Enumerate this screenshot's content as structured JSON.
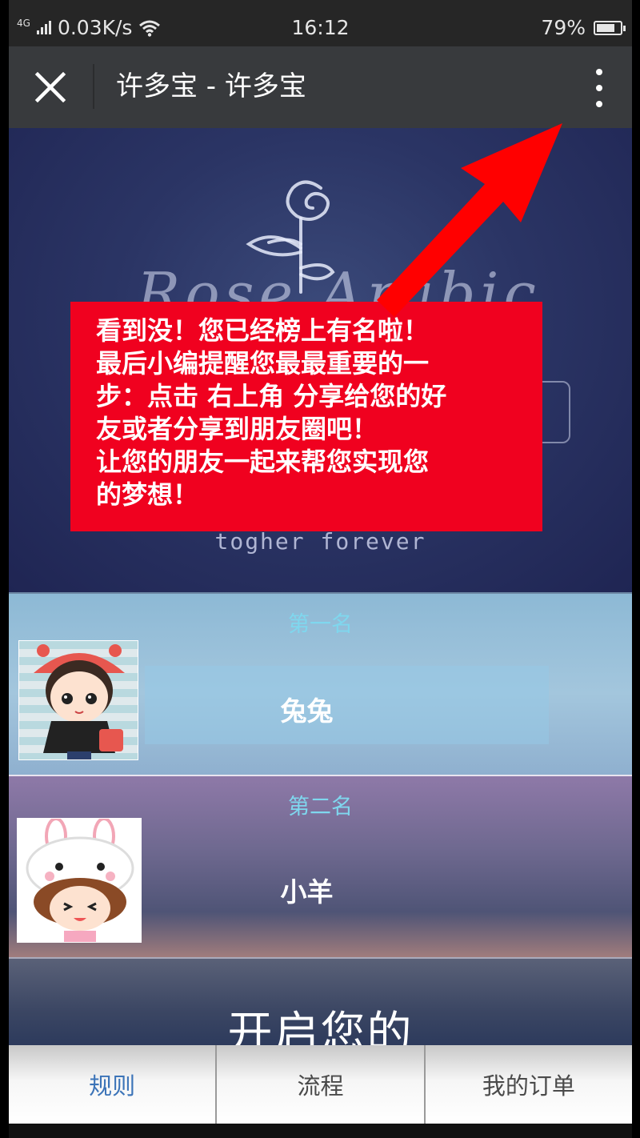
{
  "status_bar": {
    "signal_label": "4G",
    "network_speed": "0.03K/s",
    "time": "16:12",
    "battery_percent": "79%",
    "battery_level": 0.79,
    "icons": [
      "signal-icon",
      "wifi-icon",
      "battery-icon"
    ]
  },
  "title_bar": {
    "title": "许多宝 - 许多宝",
    "icons": [
      "close-icon",
      "more-icon"
    ]
  },
  "hero": {
    "tagline": "togher forever",
    "logo_script": "Rose Arabic"
  },
  "overlay": {
    "lines": [
      "看到没！您已经榜上有名啦！",
      "最后小编提醒您最最重要的一",
      "步：点击 右上角 分享给您的好",
      "友或者分享到朋友圈吧！",
      "让您的朋友一起来帮您实现您",
      "的梦想！"
    ],
    "color": "#f0011f"
  },
  "rankings": [
    {
      "label": "第一名",
      "name": "兔兔",
      "avatar": "girl-avatar"
    },
    {
      "label": "第二名",
      "name": "小羊",
      "avatar": "bunny-avatar"
    }
  ],
  "promo": {
    "text": "开启您的"
  },
  "tabs": [
    {
      "label": "规则",
      "active": true
    },
    {
      "label": "流程",
      "active": false
    },
    {
      "label": "我的订单",
      "active": false
    }
  ],
  "colors": {
    "accent_tab": "#3c74b8",
    "rank_label": "#7fd7ee",
    "arrow": "#ff0000"
  }
}
